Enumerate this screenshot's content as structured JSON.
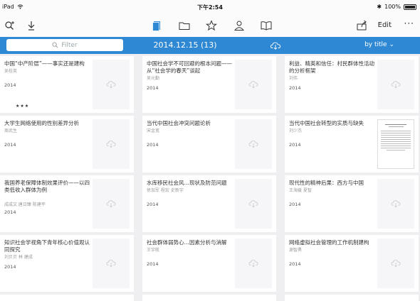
{
  "status": {
    "device": "iPad",
    "time": "下午2:54",
    "battery": "100%"
  },
  "toolbar": {
    "edit_label": "Edit",
    "more_label": "···"
  },
  "header": {
    "filter_placeholder": "Filter",
    "title": "2014.12.15 (13)",
    "sort_label": "by title"
  },
  "documents": [
    {
      "title": "中国“中产阶层”——事实还是建构",
      "author": "吴桂英",
      "year": "2014",
      "rating": "★★★"
    },
    {
      "title": "中国社会学不可回避的根本问题——从“社会学的春天”谈起",
      "author": "吴元勤",
      "year": "2014"
    },
    {
      "title": "利益、精英和信任：村民群体性活动的分析框架",
      "author": "刘伟",
      "year": "2014"
    },
    {
      "title": "大学生网络使用的性别差异分析",
      "author": "周武生",
      "year": "2014"
    },
    {
      "title": "当代中国社会冲突问题论析",
      "author": "宋金宽",
      "year": "2014"
    },
    {
      "title": "当代中国社会转型的实质与缺失",
      "author": "刘少杰",
      "year": "2014"
    },
    {
      "title": "我国养老保障体制效果评价——以四类低收入群体为例",
      "author": "成成文 唐日臻 陈建平",
      "year": "2014"
    },
    {
      "title": "水库移民社会风…现状及防范问题",
      "author": "徐加军 程宏 史新宇",
      "year": "2014"
    },
    {
      "title": "现代性的精神后果：西方与中国",
      "author": "王海媛 夏智",
      "year": "2014"
    },
    {
      "title": "知识社会学视角下青年核心价值观认同探究",
      "author": "刘贝贝 林 建成",
      "year": "2014"
    },
    {
      "title": "社会群体弱势心…因素分析与消解",
      "author": "王宇航",
      "year": "2014"
    },
    {
      "title": "网络虚拟社会管理的工作机制建构",
      "author": "谢智勇",
      "year": "2014"
    }
  ],
  "colors": {
    "accent": "#2f88d4",
    "toolbar_active": "#2f88d4"
  }
}
